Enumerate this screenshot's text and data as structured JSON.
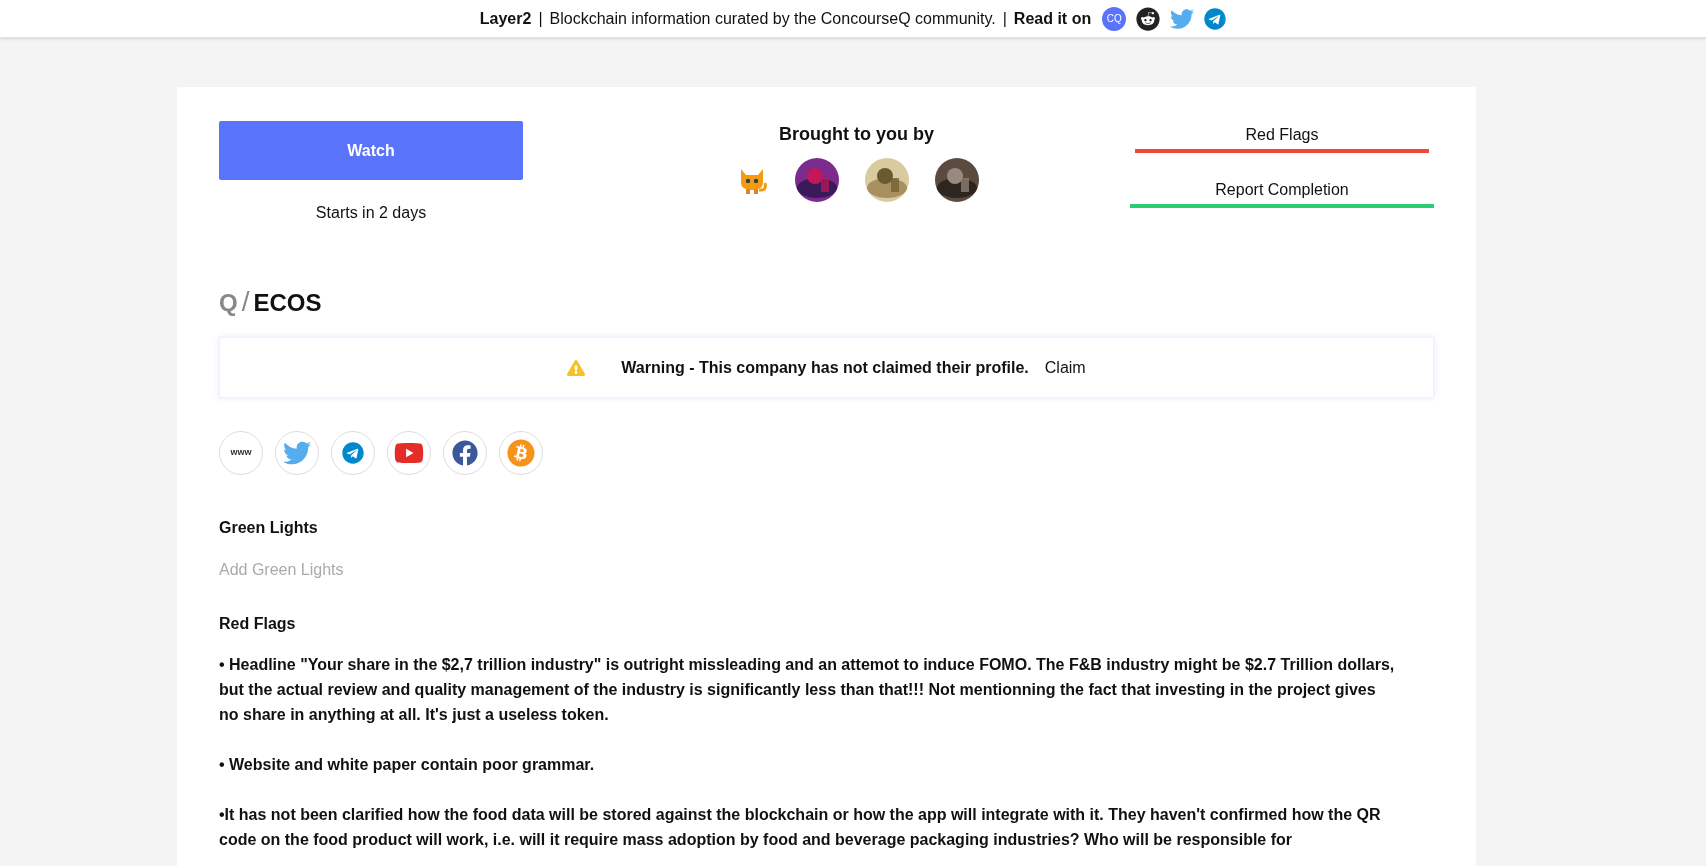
{
  "top_bar": {
    "brand": "Layer2",
    "separator_1": "|",
    "tagline": "Blockchain information curated by the ConcourseQ community.",
    "separator_2": "|",
    "read_label": "Read it on",
    "links": [
      {
        "kind": "cq",
        "text": "CQ"
      },
      {
        "kind": "reddit"
      },
      {
        "kind": "twitter"
      },
      {
        "kind": "telegram"
      }
    ]
  },
  "watch": {
    "button": "Watch",
    "starts": "Starts in 2 days"
  },
  "sponsors": {
    "title": "Brought to you by",
    "avatars": [
      {
        "kind": "cat"
      },
      {
        "kind": "picture"
      },
      {
        "kind": "picture"
      },
      {
        "kind": "picture"
      }
    ]
  },
  "report_links": [
    {
      "label": "Red Flags",
      "color": "#ef4836"
    },
    {
      "label": "Report Completion",
      "color": "#2ecc71"
    }
  ],
  "title": {
    "prefix": "Q",
    "slash": "/",
    "name": "ECOS"
  },
  "warning": {
    "text": "Warning - This company has not claimed their profile.",
    "action": "Claim"
  },
  "socials": [
    {
      "kind": "website",
      "text": "www"
    },
    {
      "kind": "twitter"
    },
    {
      "kind": "telegram"
    },
    {
      "kind": "youtube"
    },
    {
      "kind": "facebook"
    },
    {
      "kind": "bitcoin"
    }
  ],
  "green_lights": {
    "heading": "Green Lights",
    "placeholder": "Add Green Lights"
  },
  "red_flags": {
    "heading": "Red Flags",
    "paragraphs": [
      "• Headline \"Your share in the $2,7 trillion industry\" is outright missleading and an attemot to induce FOMO. The F&B industry might be $2.7 Trillion dollars, but the actual review and quality management of the industry is significantly less than that!!! Not mentionning the fact that investing in the project gives no share in anything at all. It's just a useless token.",
      "• Website and white paper contain poor grammar.",
      "•It has not been clarified how the food data will be stored against the blockchain or how the app will integrate with it.  They haven't confirmed how the QR code on the food product will work, i.e. will it require mass adoption by food and beverage packaging industries?  Who will be responsible for"
    ]
  }
}
